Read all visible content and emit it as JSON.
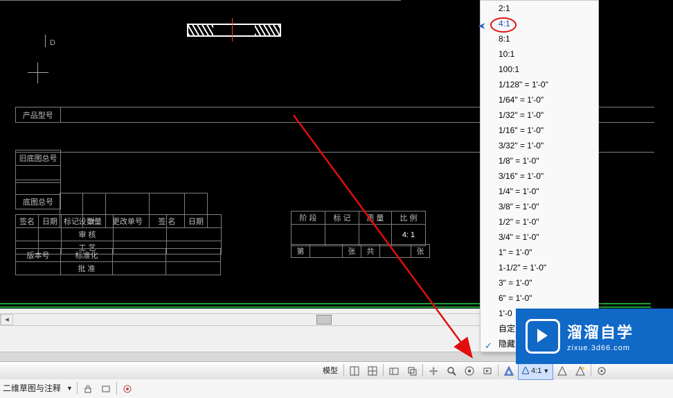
{
  "canvas": {
    "d_label": "D"
  },
  "titleblock": {
    "product_model": "产品型号",
    "old_drawing": "旧底图总号",
    "base_drawing": "底图总号",
    "headers": {
      "mark": "标记",
      "qty": "数量",
      "change_no": "更改单号",
      "sign": "签  名",
      "date": "日期"
    },
    "rows": {
      "design": "设       计",
      "review": "审       核",
      "process": "工       艺",
      "standard": "标准化",
      "approve": "批       准"
    },
    "sign_label": "签名",
    "date_label": "日期",
    "version_label": "版本号",
    "ratio": {
      "phase": "阶 段",
      "mark": "标 记",
      "quality": "质  量",
      "ratio": "比   例",
      "ratio_value": "4: 1"
    },
    "pages": {
      "di": "第",
      "zhang": "张",
      "gong": "共",
      "zhang2": "张"
    }
  },
  "scale_popup": {
    "items": [
      "2:1",
      "4:1",
      "8:1",
      "10:1",
      "100:1",
      "1/128\" = 1'-0\"",
      "1/64\" = 1'-0\"",
      "1/32\" = 1'-0\"",
      "1/16\" = 1'-0\"",
      "3/32\" = 1'-0\"",
      "1/8\" = 1'-0\"",
      "3/16\" = 1'-0\"",
      "1/4\" = 1'-0\"",
      "3/8\" = 1'-0\"",
      "1/2\" = 1'-0\"",
      "3/4\" = 1'-0\"",
      "1\" = 1'-0\"",
      "1-1/2\" = 1'-0\"",
      "3\" = 1'-0\"",
      "6\" = 1'-0\"",
      "1'-0",
      "自定",
      "隐藏"
    ],
    "selected_index": 1,
    "checked_index": 22
  },
  "statusbar": {
    "model": "模型",
    "scale_value": "4:1",
    "annot": "二维草图与注释"
  },
  "logo": {
    "brand": "溜溜自学",
    "url": "zixue.3d66.com"
  }
}
